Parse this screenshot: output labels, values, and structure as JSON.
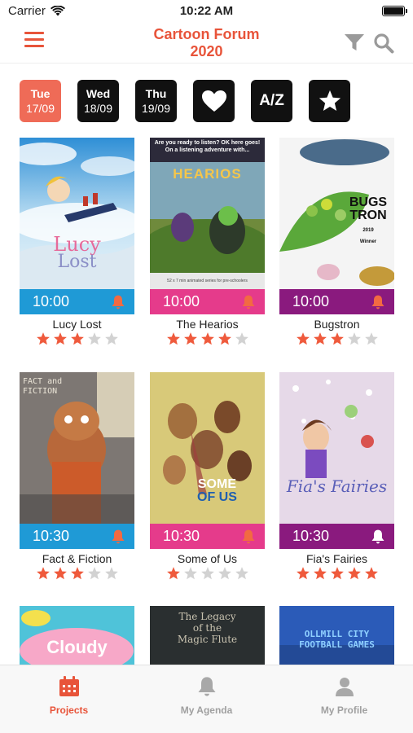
{
  "status": {
    "carrier": "Carrier",
    "time": "10:22 AM"
  },
  "header": {
    "title_line1": "Cartoon Forum",
    "title_line2": "2020"
  },
  "days": [
    {
      "dow": "Tue",
      "date": "17/09",
      "active": true
    },
    {
      "dow": "Wed",
      "date": "18/09",
      "active": false
    },
    {
      "dow": "Thu",
      "date": "19/09",
      "active": false
    }
  ],
  "filters": {
    "sort_label": "A/Z"
  },
  "projects": [
    {
      "title": "Lucy Lost",
      "time": "10:00",
      "color": "#1f9ad6",
      "rating": 3,
      "bell": "orange",
      "poster": "lucy",
      "poster_text": [
        "Lucy",
        "Lost"
      ]
    },
    {
      "title": "The Hearios",
      "time": "10:00",
      "color": "#e53b8b",
      "rating": 4,
      "bell": "orange",
      "poster": "hearios",
      "poster_text": [
        "Are you ready to listen? OK here goes!",
        "On a listening adventure with...",
        "HEARIOS",
        "52 x 7 min animated series for pre-schoolers"
      ]
    },
    {
      "title": "Bugstron",
      "time": "10:00",
      "color": "#8a1a7e",
      "rating": 3,
      "bell": "orange",
      "poster": "bugstron",
      "poster_text": [
        "BUGS",
        "TRON",
        "2019",
        "Winner"
      ]
    },
    {
      "title": "Fact & Fiction",
      "time": "10:30",
      "color": "#1f9ad6",
      "rating": 3,
      "bell": "orange",
      "poster": "fact",
      "poster_text": [
        "FACT and",
        "FICTION"
      ]
    },
    {
      "title": "Some of Us",
      "time": "10:30",
      "color": "#e53b8b",
      "rating": 1,
      "bell": "orange",
      "poster": "some",
      "poster_text": [
        "SOME",
        "OF US"
      ]
    },
    {
      "title": "Fia's Fairies",
      "time": "10:30",
      "color": "#8a1a7e",
      "rating": 5,
      "bell": "white",
      "poster": "fia",
      "poster_text": [
        "Fia's Fairies"
      ]
    },
    {
      "title": "",
      "time": "",
      "color": "",
      "rating": 0,
      "bell": "",
      "poster": "cloudy",
      "poster_text": [
        "Cloudy"
      ]
    },
    {
      "title": "",
      "time": "",
      "color": "",
      "rating": 0,
      "bell": "",
      "poster": "legacy",
      "poster_text": [
        "The Legacy",
        "of the",
        "Magic Flute"
      ]
    },
    {
      "title": "",
      "time": "",
      "color": "",
      "rating": 0,
      "bell": "",
      "poster": "ollmill",
      "poster_text": [
        "OLLMILL CITY",
        "FOOTBALL GAMES"
      ]
    }
  ],
  "tabs": [
    {
      "label": "Projects",
      "icon": "calendar-icon",
      "active": true
    },
    {
      "label": "My Agenda",
      "icon": "bell-icon",
      "active": false
    },
    {
      "label": "My Profile",
      "icon": "person-icon",
      "active": false
    }
  ],
  "colors": {
    "accent": "#e8543a",
    "star_on": "#ef5a3c",
    "star_off": "#d2d2d2"
  }
}
